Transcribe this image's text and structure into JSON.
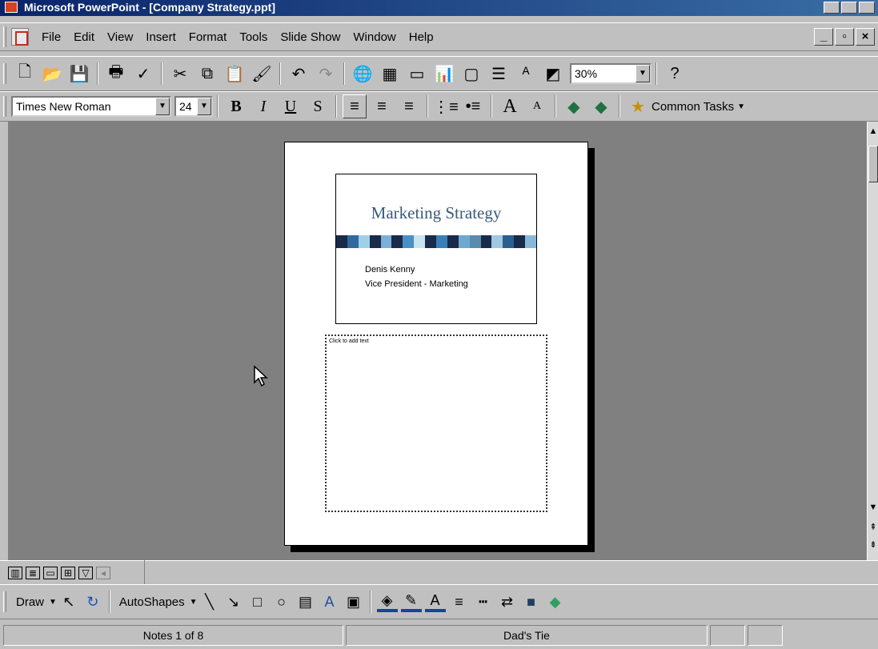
{
  "window": {
    "title": "Microsoft PowerPoint - [Company Strategy.ppt]"
  },
  "menu": {
    "items": [
      "File",
      "Edit",
      "View",
      "Insert",
      "Format",
      "Tools",
      "Slide Show",
      "Window",
      "Help"
    ]
  },
  "standard_toolbar": {
    "zoom": "30%"
  },
  "formatting_toolbar": {
    "font_name": "Times New Roman",
    "font_size": "24",
    "bold": "B",
    "italic": "I",
    "underline": "U",
    "shadow": "S",
    "common_tasks": "Common Tasks"
  },
  "slide": {
    "title": "Marketing Strategy",
    "line1": "Denis Kenny",
    "line2": "Vice President - Marketing",
    "band_colors": [
      "#1a2a4a",
      "#2f6aa0",
      "#9fd0e8",
      "#1a2a4a",
      "#7ab0d8",
      "#1a2a4a",
      "#4a90c8",
      "#c8e4f0",
      "#1a2a4a",
      "#3a80b8",
      "#1a2a4a",
      "#6fa8d0",
      "#5a8ab0",
      "#1a2a4a",
      "#a0c8e0",
      "#2a6090",
      "#1a2a4a",
      "#88b8d8"
    ]
  },
  "notes": {
    "label": "Click to add text"
  },
  "draw_toolbar": {
    "draw": "Draw",
    "autoshapes": "AutoShapes"
  },
  "status": {
    "page": "Notes 1 of 8",
    "design": "Dad's Tie"
  }
}
